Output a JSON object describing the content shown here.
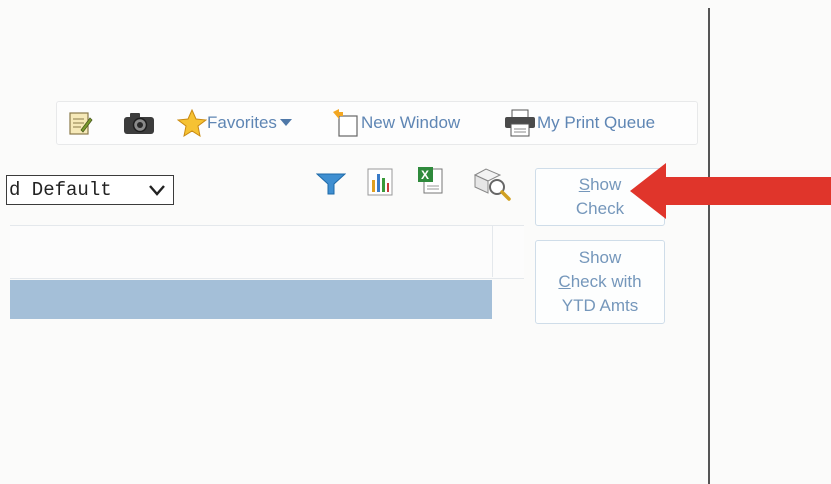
{
  "toolbar": {
    "favorites_label": "Favorites",
    "new_window_label": "New Window",
    "print_queue_label": "My Print Queue"
  },
  "view_select": {
    "value": "d Default"
  },
  "buttons": {
    "show_check": {
      "mnemonic": "S",
      "rest": "how",
      "line2": "Check"
    },
    "show_check_ytd": {
      "line1": "Show",
      "mnemonic": "C",
      "rest": "heck with",
      "line3": "YTD Amts"
    }
  },
  "colors": {
    "accent": "#5f86b4",
    "grid_bar": "#a4bfd8",
    "arrow": "#e0352b"
  }
}
